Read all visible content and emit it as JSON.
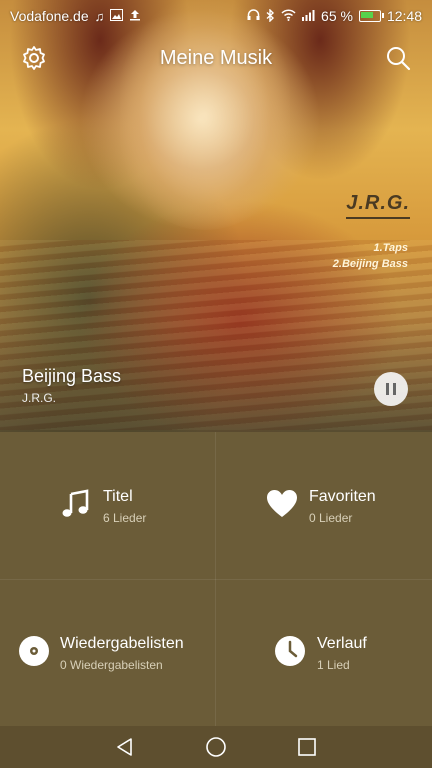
{
  "status_bar": {
    "carrier": "Vodafone.de",
    "battery_percent": "65 %",
    "battery_level": 0.65,
    "time": "12:48",
    "icons": [
      "music-icon",
      "image-icon",
      "upload-icon",
      "headphones-icon",
      "bluetooth-icon",
      "wifi-icon",
      "signal-icon",
      "battery-icon"
    ]
  },
  "header": {
    "title": "Meine Musik",
    "left_icon": "gear-icon",
    "right_icon": "search-icon"
  },
  "album_art": {
    "artist": "J.R.G.",
    "tracks": [
      "1.Taps",
      "2.Beijing Bass"
    ]
  },
  "now_playing": {
    "title": "Beijing Bass",
    "artist": "J.R.G.",
    "control_icon": "pause-icon"
  },
  "categories": [
    {
      "label": "Titel",
      "count": "6 Lieder",
      "icon": "music-note-icon"
    },
    {
      "label": "Favoriten",
      "count": "0 Lieder",
      "icon": "heart-icon"
    },
    {
      "label": "Wiedergabelisten",
      "count": "0 Wiedergabelisten",
      "icon": "disc-icon"
    },
    {
      "label": "Verlauf",
      "count": "1 Lied",
      "icon": "clock-icon"
    }
  ],
  "nav_bar": {
    "icons": [
      "back-icon",
      "home-icon",
      "recents-icon"
    ]
  },
  "colors": {
    "panel": "#6b5c38",
    "navbar": "#5e4f2f",
    "battery_fill": "#57d24c"
  }
}
